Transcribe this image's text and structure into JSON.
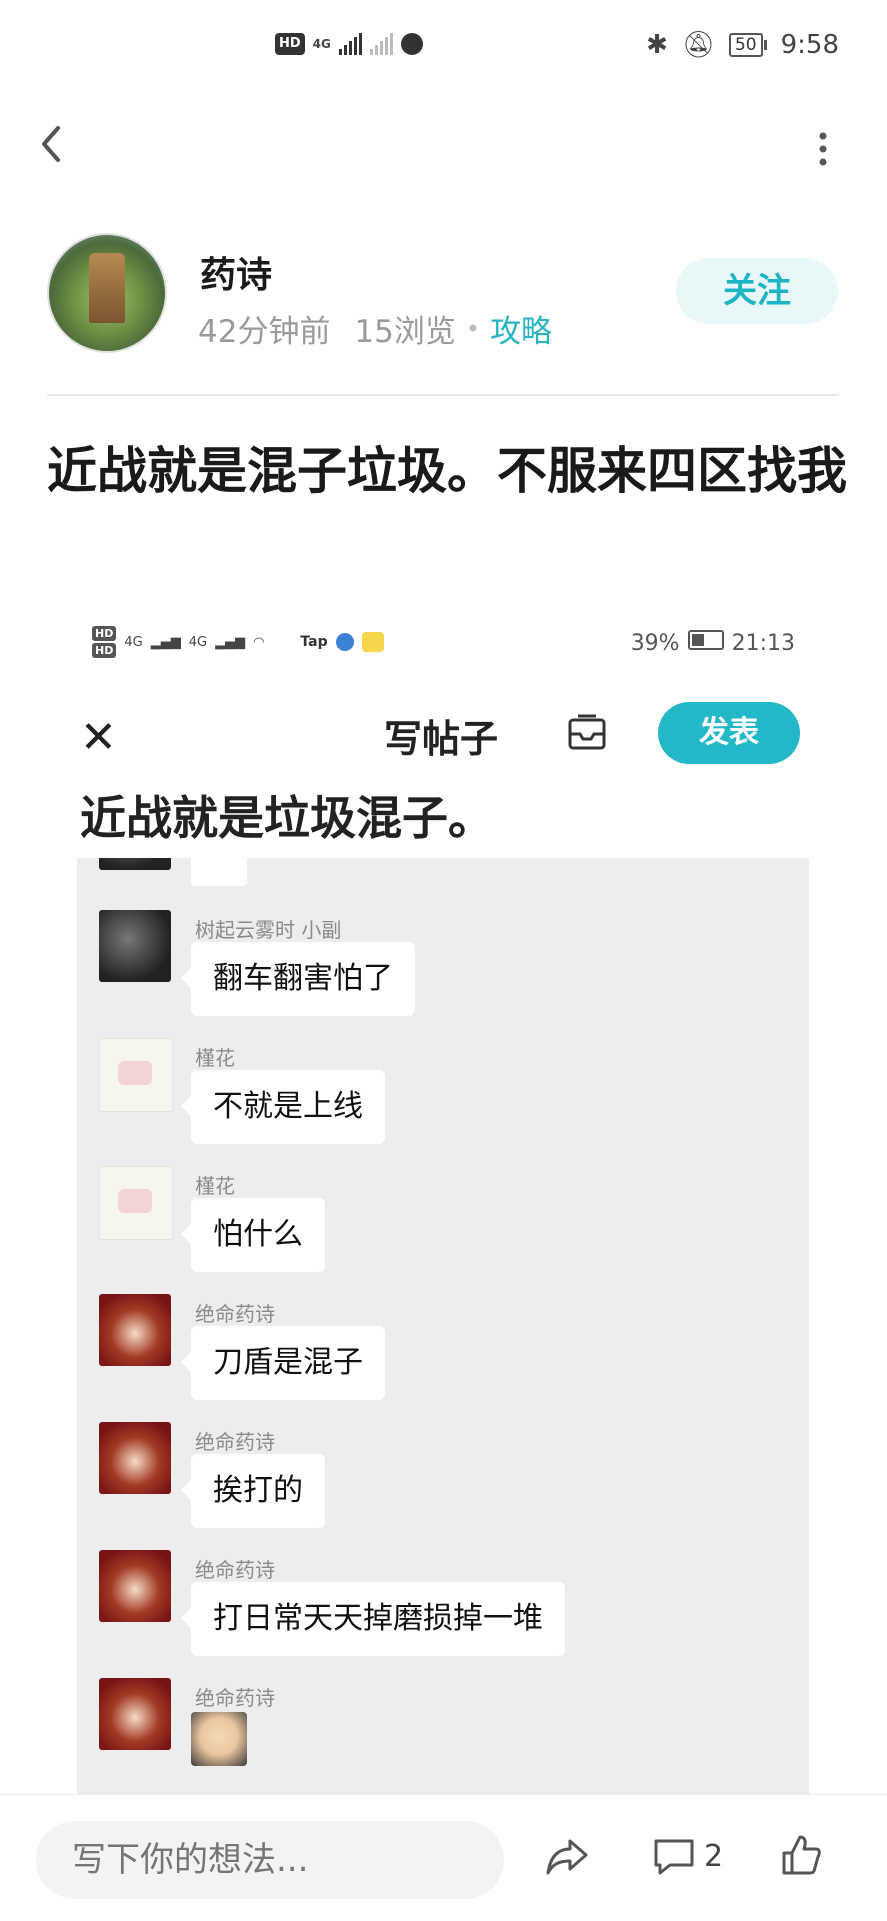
{
  "status_bar": {
    "hd": "HD",
    "net1": "4G",
    "battery": "50",
    "time": "9:58"
  },
  "author": {
    "name": "药诗",
    "time_ago": "42分钟前",
    "views": "15浏览",
    "tag": "攻略",
    "follow_label": "关注"
  },
  "post": {
    "title": "近战就是混子垃圾。不服来四区找我"
  },
  "embedded": {
    "status": {
      "hd1": "HD",
      "hd2": "HD",
      "net": "4G",
      "net2": "4G",
      "tap": "Tap",
      "battery": "39%",
      "time": "21:13"
    },
    "header_title": "写帖子",
    "publish_label": "发表",
    "post_title": "近战就是垃圾混子。",
    "messages": [
      {
        "sender": "树起云雾时 小副",
        "text": "翻车翻害怕了",
        "avatar": "dark"
      },
      {
        "sender": "槿花",
        "text": "不就是上线",
        "avatar": "paper"
      },
      {
        "sender": "槿花",
        "text": "怕什么",
        "avatar": "paper"
      },
      {
        "sender": "绝命药诗",
        "text": "刀盾是混子",
        "avatar": "red"
      },
      {
        "sender": "绝命药诗",
        "text": "挨打的",
        "avatar": "red"
      },
      {
        "sender": "绝命药诗",
        "text": "打日常天天掉磨损掉一堆",
        "avatar": "red"
      },
      {
        "sender": "绝命药诗",
        "text": "",
        "avatar": "red"
      }
    ]
  },
  "bottom_bar": {
    "comment_placeholder": "写下你的想法...",
    "comment_count": "2"
  },
  "colors": {
    "accent": "#22b8c8",
    "chat_bg": "#ededed"
  }
}
